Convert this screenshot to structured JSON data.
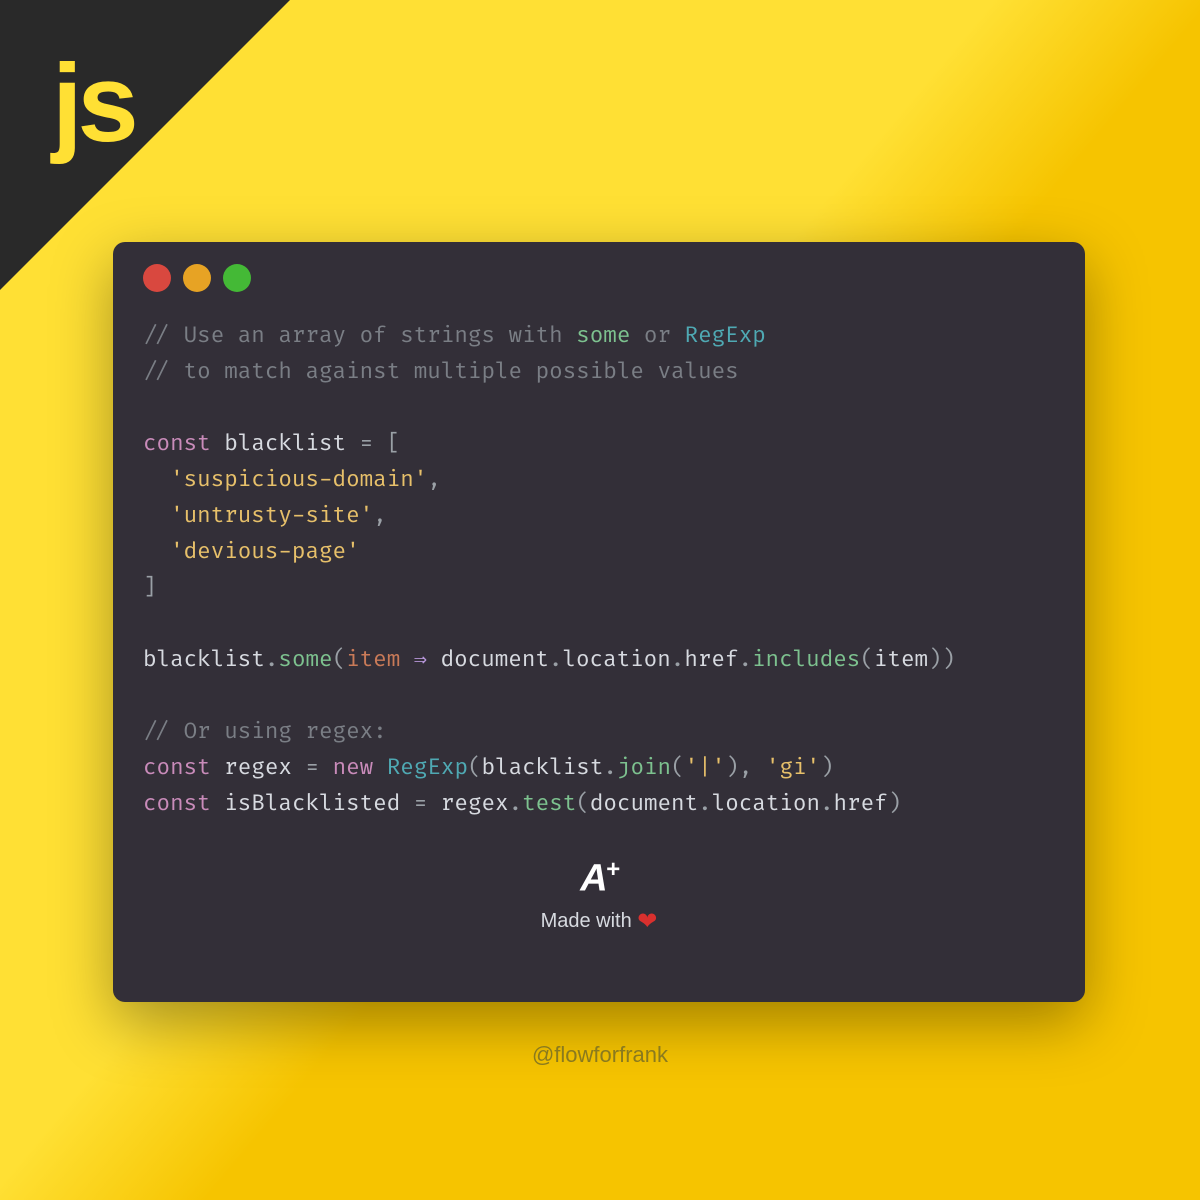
{
  "badge": {
    "js": "js"
  },
  "code": {
    "c1a": "// Use an array of strings with ",
    "c1b": "some",
    "c1c": " or ",
    "c1d": "RegExp",
    "c2": "// to match against multiple possible values",
    "kw_const": "const",
    "kw_new": "new",
    "blacklist": "blacklist",
    "regex_var": "regex",
    "isBlacklisted": "isBlacklisted",
    "eq": " = ",
    "lbr": "[",
    "rbr": "]",
    "s1": "'suspicious-domain'",
    "s2": "'untrusty-site'",
    "s3": "'devious-page'",
    "some": "some",
    "item": "item",
    "arrow": " ⇒ ",
    "document": "document",
    "location": "location",
    "href": "href",
    "includes": "includes",
    "dot": ".",
    "lp": "(",
    "rp": ")",
    "comma": ",",
    "c3": "// Or using regex:",
    "RegExp": "RegExp",
    "join": "join",
    "pipe": "'|'",
    "gi": "'gi'",
    "test": "test"
  },
  "footer": {
    "a": "A",
    "plus": "+",
    "made": "Made with "
  },
  "handle": "@flowforfrank"
}
